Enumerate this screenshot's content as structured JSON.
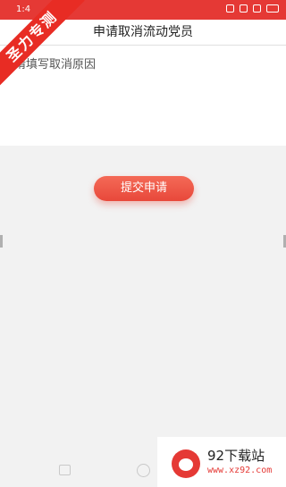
{
  "status_bar": {
    "time": "1:4"
  },
  "header": {
    "title": "申请取消流动党员"
  },
  "form": {
    "reason_placeholder": "请填写取消原因",
    "submit_label": "提交申请"
  },
  "ribbon": {
    "text": "圣力专测"
  },
  "watermark": {
    "name": "92下载站",
    "url": "www.xz92.com"
  },
  "colors": {
    "accent": "#e53935",
    "button": "#ef5b4c",
    "background": "#f2f2f2"
  }
}
